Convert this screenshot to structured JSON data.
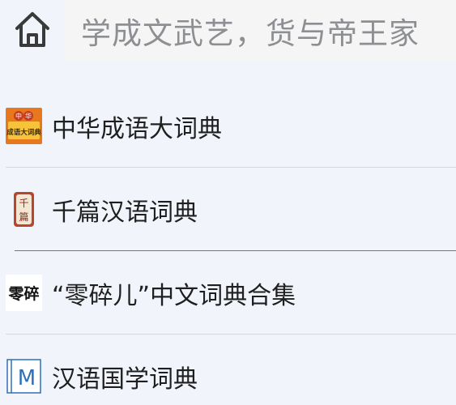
{
  "header": {
    "home_icon": "home-icon",
    "search_text": "学成文武艺，货与帝王家"
  },
  "list": {
    "items": [
      {
        "label": "中华成语大词典",
        "icon": "chengyu-dictionary-icon",
        "icon_text_top": "中华",
        "icon_text_bottom": "成语大词典"
      },
      {
        "label": "千篇汉语词典",
        "icon": "qianpian-seal-icon",
        "icon_text_top": "千",
        "icon_text_bottom": "篇"
      },
      {
        "label": "“零碎儿”中文词典合集",
        "icon": "lingsui-calligraphy-icon",
        "icon_text": "零碎"
      },
      {
        "label": "汉语国学词典",
        "icon": "m-letter-icon",
        "icon_text": "M"
      }
    ]
  },
  "colors": {
    "background": "#f1f5fb",
    "search_bg": "#f5f5f6",
    "accent_divider": "#4c7cc4"
  }
}
